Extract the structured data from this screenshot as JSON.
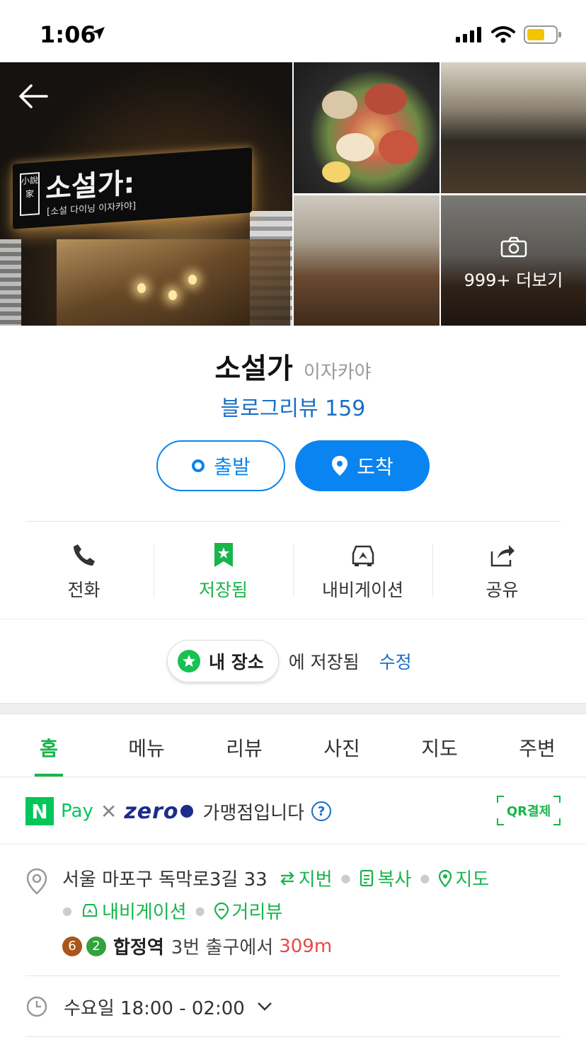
{
  "status_bar": {
    "time": "1:06"
  },
  "gallery": {
    "sign_title": "소설가:",
    "sign_box": "小說家",
    "sign_sub": "[소설 다이닝 이자카야]",
    "more_label": "999+ 더보기"
  },
  "place": {
    "name": "소설가",
    "category": "이자카야",
    "blog_review": "블로그리뷰 159"
  },
  "route": {
    "depart": "출발",
    "arrive": "도착"
  },
  "actions": [
    {
      "label": "전화",
      "icon": "phone-icon"
    },
    {
      "label": "저장됨",
      "icon": "bookmark-star-icon"
    },
    {
      "label": "내비게이션",
      "icon": "car-navigation-icon"
    },
    {
      "label": "공유",
      "icon": "share-icon"
    }
  ],
  "saved": {
    "chip": "내 장소",
    "text": "에 저장됨",
    "edit": "수정"
  },
  "tabs": [
    "홈",
    "메뉴",
    "리뷰",
    "사진",
    "지도",
    "주변"
  ],
  "npay": {
    "n": "N",
    "pay": "Pay",
    "times": "✕",
    "zero": "zero",
    "zero_dot": "Pay",
    "affiliate": "가맹점입니다",
    "help": "?",
    "qr": "QR결제"
  },
  "address": {
    "text": "서울 마포구 독막로3길 33",
    "jibun": "지번",
    "copy": "복사",
    "map": "지도",
    "navigation": "내비게이션",
    "street_view": "거리뷰",
    "line6": "6",
    "line2": "2",
    "station": "합정역",
    "exit": "3번 출구에서",
    "distance": "309m"
  },
  "hours": {
    "text": "수요일 18:00 - 02:00"
  },
  "colors": {
    "green": "#19b44b",
    "blue": "#0a84f0",
    "link_blue": "#1a6fc4",
    "line6": "#a9561c",
    "line2": "#33a23d",
    "distance_red": "#e8484a"
  }
}
